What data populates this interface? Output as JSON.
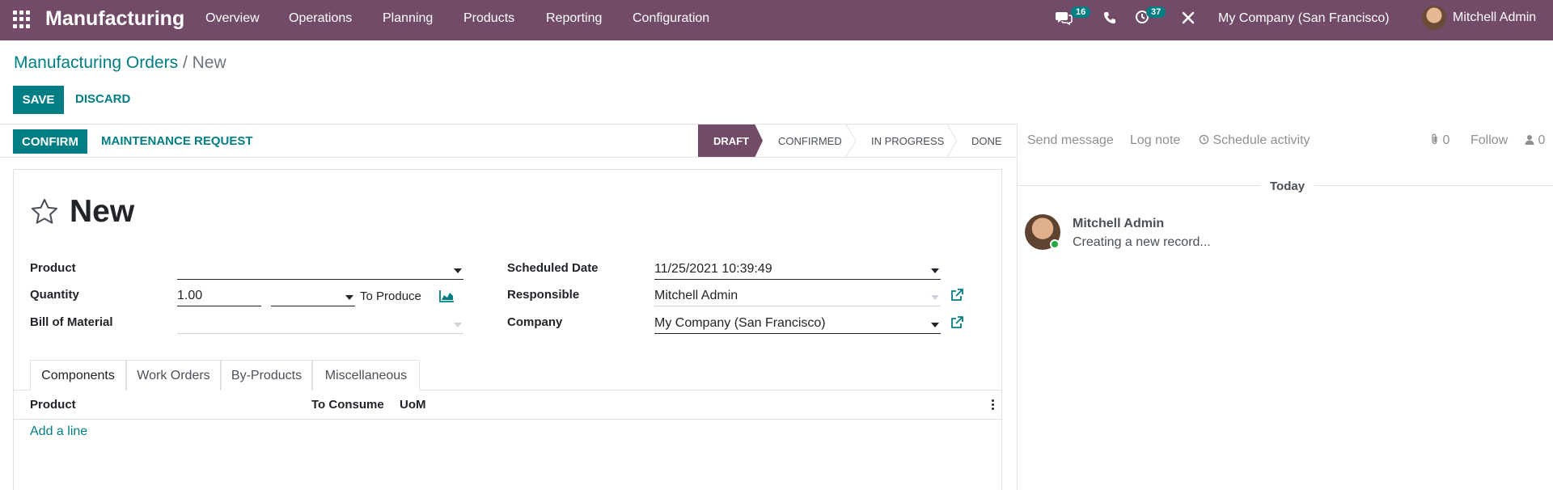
{
  "navbar": {
    "app_name": "Manufacturing",
    "menu": [
      "Overview",
      "Operations",
      "Planning",
      "Products",
      "Reporting",
      "Configuration"
    ],
    "messages_count": "16",
    "activities_count": "37",
    "company": "My Company (San Francisco)",
    "user": "Mitchell Admin",
    "icons": [
      "apps-icon",
      "chat-icon",
      "phone-icon",
      "clock-icon",
      "tools-icon"
    ]
  },
  "breadcrumb": {
    "parent": "Manufacturing Orders",
    "separator": "/",
    "current": "New"
  },
  "actions": {
    "save": "SAVE",
    "discard": "DISCARD"
  },
  "statusbar": {
    "confirm": "CONFIRM",
    "maintenance": "MAINTENANCE REQUEST",
    "stages": [
      "DRAFT",
      "CONFIRMED",
      "IN PROGRESS",
      "DONE"
    ],
    "active_stage": "DRAFT"
  },
  "chatter": {
    "send_message": "Send message",
    "log_note": "Log note",
    "schedule_activity": "Schedule activity",
    "attachments_count": "0",
    "follow": "Follow",
    "followers_count": "0",
    "date_separator": "Today",
    "message": {
      "author": "Mitchell Admin",
      "body": "Creating a new record..."
    }
  },
  "form": {
    "title": "New",
    "product": {
      "label": "Product",
      "value": ""
    },
    "quantity": {
      "label": "Quantity",
      "value": "1.00",
      "uom": "",
      "suffix": "To Produce"
    },
    "bom": {
      "label": "Bill of Material",
      "value": ""
    },
    "scheduled_date": {
      "label": "Scheduled Date",
      "value": "11/25/2021 10:39:49"
    },
    "responsible": {
      "label": "Responsible",
      "value": "Mitchell Admin"
    },
    "company": {
      "label": "Company",
      "value": "My Company (San Francisco)"
    }
  },
  "tabs": [
    "Components",
    "Work Orders",
    "By-Products",
    "Miscellaneous"
  ],
  "active_tab": "Components",
  "components_table": {
    "columns": [
      "Product",
      "To Consume",
      "UoM"
    ],
    "rows": [],
    "add_line": "Add a line"
  },
  "colors": {
    "brand": "#714B67",
    "accent": "#017e84"
  }
}
